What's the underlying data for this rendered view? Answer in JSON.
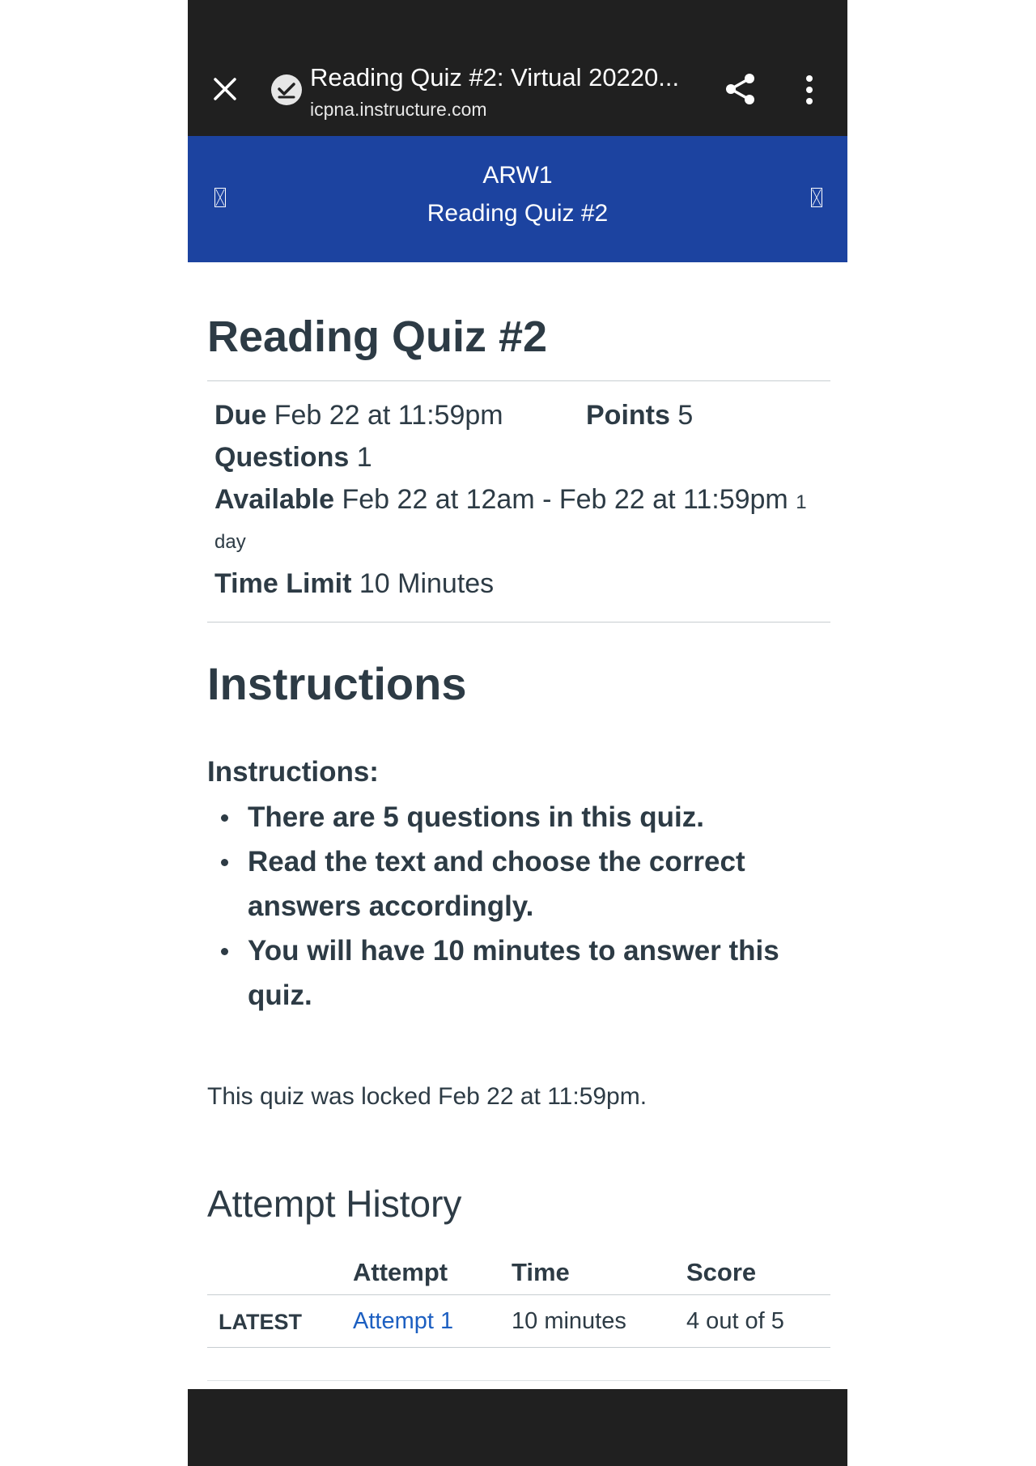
{
  "browser": {
    "page_title": "Reading Quiz #2: Virtual 20220...",
    "url": "icpna.instructure.com",
    "icons": [
      "close-icon",
      "site-verified-icon",
      "share-icon",
      "more-vert-icon"
    ]
  },
  "course_bar": {
    "course": "ARW1",
    "item": "Reading Quiz #2",
    "color": "#1c43a0"
  },
  "quiz": {
    "title": "Reading Quiz #2",
    "due_label": "Due",
    "due_value": "Feb 22 at 11:59pm",
    "points_label": "Points",
    "points_value": "5",
    "questions_label": "Questions",
    "questions_value": "1",
    "available_label": "Available",
    "available_value": "Feb 22 at 12am - Feb 22 at 11:59pm",
    "available_duration_1": "1",
    "available_duration_2": "day",
    "time_limit_label": "Time Limit",
    "time_limit_value": "10 Minutes"
  },
  "instructions": {
    "heading": "Instructions",
    "subheading": "Instructions:",
    "items": [
      "There are 5 questions in this quiz.",
      "Read the text and choose the correct answers accordingly.",
      "You will have 10 minutes to answer this quiz."
    ],
    "locked_note": "This quiz was locked Feb 22 at 11:59pm."
  },
  "attempt_history": {
    "heading": "Attempt History",
    "columns": [
      "Attempt",
      "Time",
      "Score"
    ],
    "rows": [
      {
        "label": "LATEST",
        "attempt": "Attempt 1",
        "time": "10 minutes",
        "score": "4 out of 5"
      }
    ],
    "link_color": "#1c5fc1"
  }
}
